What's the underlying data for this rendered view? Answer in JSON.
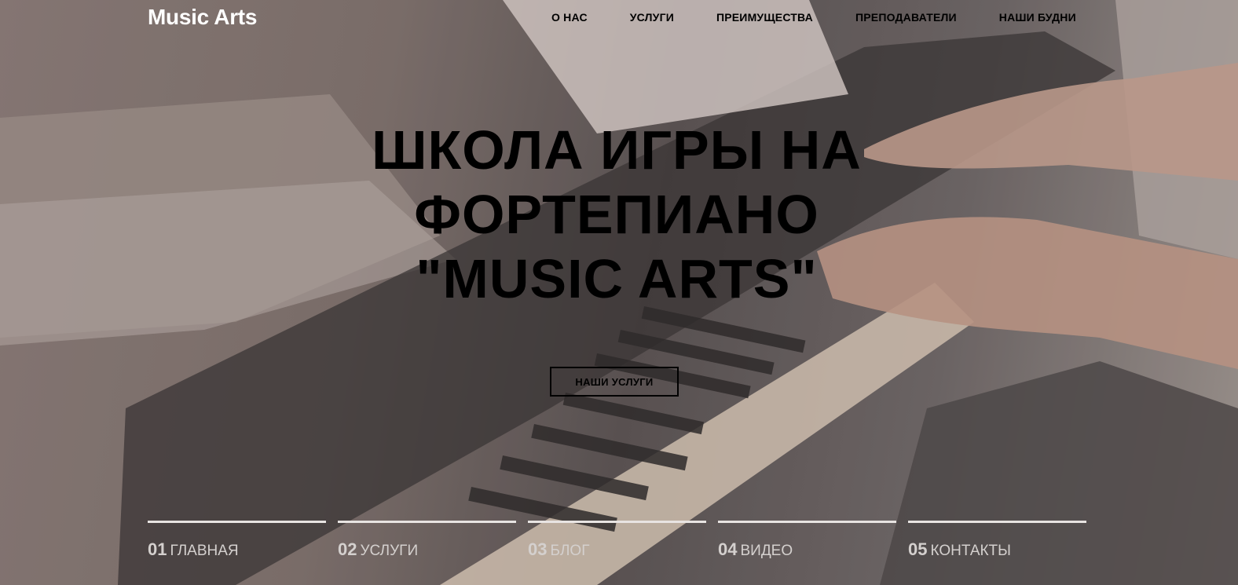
{
  "header": {
    "logo": "Music Arts",
    "nav": [
      {
        "label": "О НАС"
      },
      {
        "label": "УСЛУГИ"
      },
      {
        "label": "ПРЕИМУЩЕСТВА"
      },
      {
        "label": "ПРЕПОДАВАТЕЛИ"
      },
      {
        "label": "НАШИ БУДНИ"
      }
    ]
  },
  "hero": {
    "title_lines": [
      "ШКОЛА ИГРЫ НА",
      "ФОРТЕПИАНО",
      "\"MUSIC ARTS\""
    ],
    "button": "НАШИ УСЛУГИ"
  },
  "slider": [
    {
      "num": "01",
      "label": "ГЛАВНАЯ"
    },
    {
      "num": "02",
      "label": "УСЛУГИ"
    },
    {
      "num": "03",
      "label": "БЛОГ"
    },
    {
      "num": "04",
      "label": "ВИДЕО"
    },
    {
      "num": "05",
      "label": "КОНТАКТЫ"
    }
  ],
  "colors": {
    "title": "#000000",
    "logo": "#ffffff",
    "slider_text": "#d4d0ce"
  }
}
